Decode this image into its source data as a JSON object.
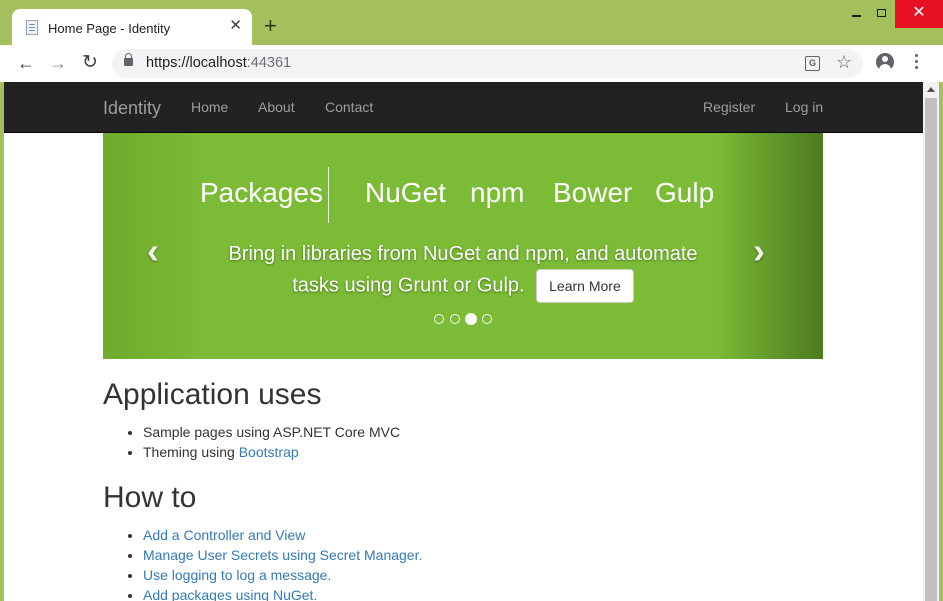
{
  "browser": {
    "tab_title": "Home Page - Identity",
    "tab_close": "✕",
    "new_tab": "+",
    "url_host": "https://localhost",
    "url_port": ":44361",
    "window_controls": {
      "close": "✕"
    }
  },
  "navbar": {
    "brand": "Identity",
    "links": [
      "Home",
      "About",
      "Contact"
    ],
    "right_links": [
      "Register",
      "Log in"
    ]
  },
  "carousel": {
    "packages_label": "Packages",
    "tools": [
      "NuGet",
      "npm",
      "Bower",
      "Gulp"
    ],
    "caption": "Bring in libraries from NuGet and npm, and automate tasks using Grunt or Gulp.",
    "button": "Learn More",
    "prev_icon": "‹",
    "next_icon": "›",
    "slide_count": 4,
    "active_slide": 3,
    "background_color": "#7bbb35"
  },
  "sections": [
    {
      "heading": "Application uses",
      "items": [
        {
          "text": "Sample pages using ASP.NET Core MVC",
          "link": ""
        },
        {
          "text": "Theming using ",
          "link": "Bootstrap"
        }
      ]
    },
    {
      "heading": "How to",
      "items": [
        {
          "text": "",
          "link": "Add a Controller and View"
        },
        {
          "text": "",
          "link": "Manage User Secrets using Secret Manager."
        },
        {
          "text": "",
          "link": "Use logging to log a message."
        },
        {
          "text": "",
          "link": "Add packages using NuGet."
        }
      ]
    }
  ],
  "colors": {
    "chrome_frame": "#a4c05c",
    "navbar_bg": "#222222",
    "link": "#337ab7"
  }
}
